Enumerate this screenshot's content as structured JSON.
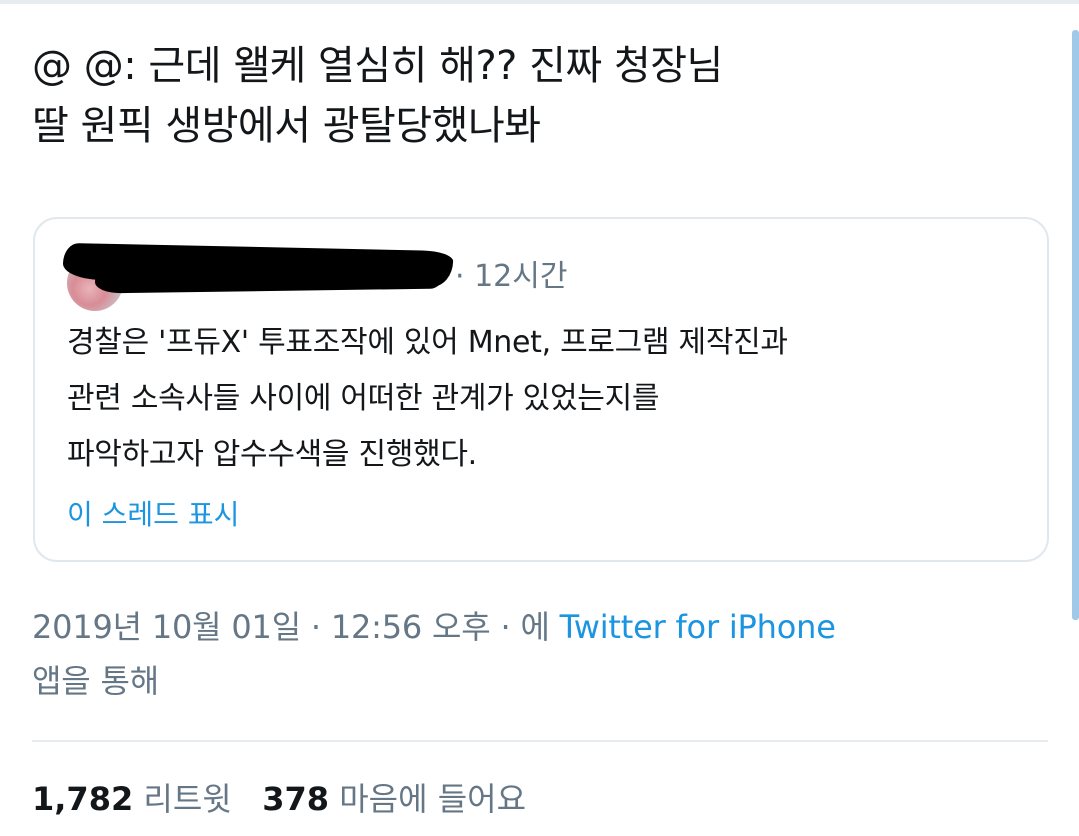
{
  "tweet": {
    "text_line1": "@ @: 근데 왤케 열심히 해?? 진짜 청장님",
    "text_line2": "딸 원픽 생방에서 광탈당했나봐"
  },
  "quoted_tweet": {
    "time": "· 12시간",
    "body_line1": "경찰은 '프듀X' 투표조작에 있어 Mnet, 프로그램 제작진과",
    "body_line2": "관련 소속사들 사이에 어떠한 관계가 있었는지를",
    "body_line3": "파악하고자 압수수색을 진행했다.",
    "show_thread": "이 스레드 표시"
  },
  "meta": {
    "date": "2019년 10월 01일 · 12:56 오후 · 에",
    "source": "Twitter for iPhone",
    "suffix": "앱을 통해"
  },
  "stats": {
    "retweets_count": "1,782",
    "retweets_label": "리트윗",
    "likes_count": "378",
    "likes_label": "마음에 들어요"
  },
  "colors": {
    "link": "#1b95e0",
    "secondary_text": "#657786",
    "primary_text": "#14171a",
    "border": "#e1e8ed"
  }
}
